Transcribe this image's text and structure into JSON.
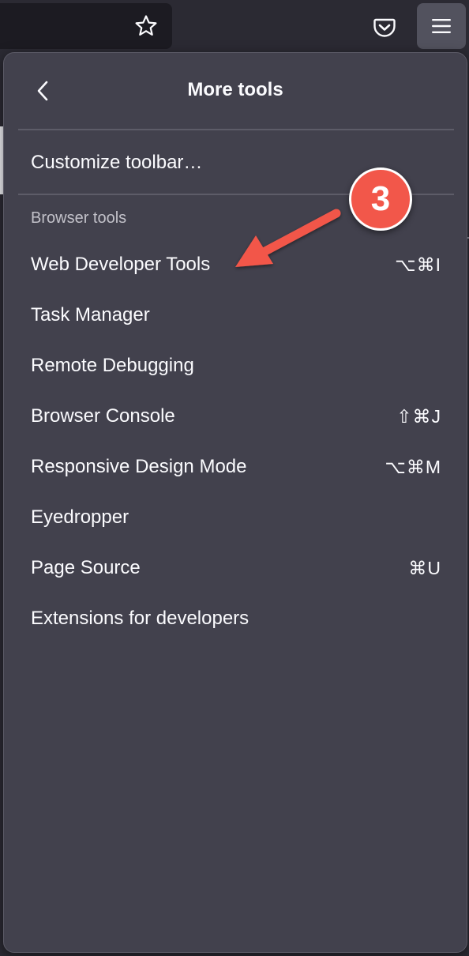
{
  "toolbar": {
    "bookmark_icon": "star-outline-icon",
    "pocket_icon": "pocket-icon",
    "menu_icon": "hamburger-menu-icon"
  },
  "panel": {
    "title": "More tools",
    "back_icon": "chevron-left-icon",
    "customize_label": "Customize toolbar…",
    "section_header": "Browser tools",
    "items": [
      {
        "label": "Web Developer Tools",
        "shortcut": "⌥⌘I"
      },
      {
        "label": "Task Manager",
        "shortcut": ""
      },
      {
        "label": "Remote Debugging",
        "shortcut": ""
      },
      {
        "label": "Browser Console",
        "shortcut": "⇧⌘J"
      },
      {
        "label": "Responsive Design Mode",
        "shortcut": "⌥⌘M"
      },
      {
        "label": "Eyedropper",
        "shortcut": ""
      },
      {
        "label": "Page Source",
        "shortcut": "⌘U"
      },
      {
        "label": "Extensions for developers",
        "shortcut": ""
      }
    ]
  },
  "annotation": {
    "step_number": "3",
    "badge_color": "#f2574a",
    "arrow_color": "#f2574a"
  },
  "colors": {
    "panel_bg": "#42414d",
    "toolbar_bg": "#2b2a33",
    "text": "#fbfbfe",
    "muted_text": "#c2c1c9"
  }
}
